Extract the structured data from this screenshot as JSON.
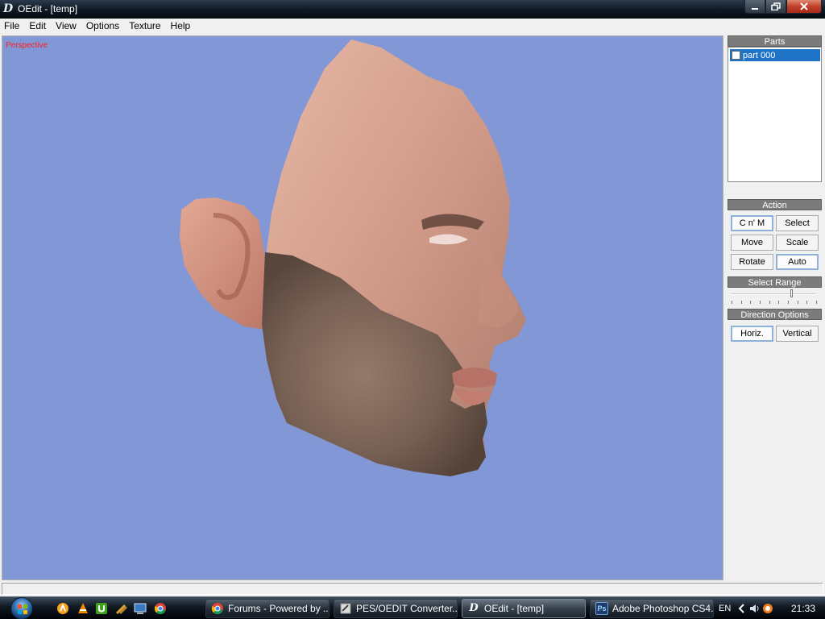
{
  "window": {
    "title": "OEdit - [temp]",
    "minimize_label": "—",
    "maximize_label": "❐",
    "close_label": "✕"
  },
  "menu": [
    "File",
    "Edit",
    "View",
    "Options",
    "Texture",
    "Help"
  ],
  "viewport": {
    "mode_label": "Perspective",
    "background_color": "#8197d6"
  },
  "panel": {
    "parts_header": "Parts",
    "parts": [
      {
        "label": "part 000",
        "checked": false,
        "selected": true
      }
    ],
    "action_header": "Action",
    "action_buttons": {
      "cnm": "C n' M",
      "select": "Select",
      "move": "Move",
      "scale": "Scale",
      "rotate": "Rotate",
      "auto": "Auto"
    },
    "select_range_header": "Select Range",
    "select_range_value": 0.7,
    "direction_header": "Direction Options",
    "direction_buttons": {
      "horiz": "Horiz.",
      "vertical": "Vertical"
    }
  },
  "taskbar": {
    "tasks": [
      {
        "label": "Forums - Powered by ...",
        "icon": "chrome-icon"
      },
      {
        "label": "PES/OEDIT Converter...",
        "icon": "converter-icon"
      },
      {
        "label": "OEdit - [temp]",
        "icon": "oedit-icon"
      },
      {
        "label": "Adobe Photoshop CS4...",
        "icon": "photoshop-icon"
      }
    ],
    "language": "EN",
    "clock": "21:33"
  }
}
